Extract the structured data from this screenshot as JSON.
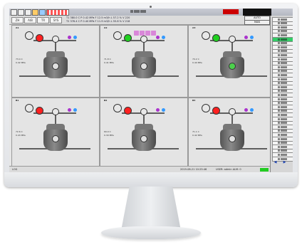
{
  "window": {
    "title_glyphs": 5
  },
  "toolbar": {
    "buttons": [
      "ZH",
      "A/B",
      "TR",
      "SYS"
    ],
    "status_line1": "T1 380.0 C  P 0.42 MPa  F 12.5 m3/h  L 57.2 %  V 220",
    "status_line2": "T2 376.4 C  P 0.40 MPa  F 11.9 m3/h  L 55.8 %  V 218",
    "mode_buttons": [
      "AUTO",
      "MAN"
    ]
  },
  "overlay_title_glyphs": 4,
  "panels": [
    {
      "id": "A1",
      "temp": "73.4",
      "press": "0.42",
      "lamp_color": "#ff2020",
      "cone_color": "#e0e0e0"
    },
    {
      "id": "A2",
      "temp": "71.8",
      "press": "0.41",
      "lamp_color": "#20d020",
      "cone_color": "#e0e0e0"
    },
    {
      "id": "A3",
      "temp": "70.2",
      "press": "0.40",
      "lamp_color": "#20d020",
      "cone_color": "#4cd04c"
    },
    {
      "id": "B1",
      "temp": "72.6",
      "press": "0.43",
      "lamp_color": "#ff2020",
      "cone_color": "#e0e0e0"
    },
    {
      "id": "B2",
      "temp": "69.9",
      "press": "0.39",
      "lamp_color": "#ff2020",
      "cone_color": "#e0e0e0"
    },
    {
      "id": "B3",
      "temp": "71.1",
      "press": "0.42",
      "lamp_color": "#ff2020",
      "cone_color": "#e0e0e0"
    }
  ],
  "sidebar": {
    "items": [
      {
        "label_glyphs": 4,
        "active": false
      },
      {
        "label_glyphs": 4,
        "active": false
      },
      {
        "label_glyphs": 4,
        "active": false
      },
      {
        "label_glyphs": 4,
        "active": false
      },
      {
        "label_glyphs": 4,
        "active": false
      },
      {
        "label_glyphs": 4,
        "active": true
      },
      {
        "label_glyphs": 4,
        "active": false
      },
      {
        "label_glyphs": 4,
        "active": false
      },
      {
        "label_glyphs": 4,
        "active": false
      },
      {
        "label_glyphs": 4,
        "active": false
      },
      {
        "label_glyphs": 4,
        "active": false
      },
      {
        "label_glyphs": 4,
        "active": false
      },
      {
        "label_glyphs": 4,
        "active": false
      },
      {
        "label_glyphs": 4,
        "active": false
      },
      {
        "label_glyphs": 4,
        "active": false
      },
      {
        "label_glyphs": 4,
        "active": false
      },
      {
        "label_glyphs": 4,
        "active": false
      },
      {
        "label_glyphs": 4,
        "active": false
      },
      {
        "label_glyphs": 4,
        "active": false
      },
      {
        "label_glyphs": 4,
        "active": false
      },
      {
        "label_glyphs": 4,
        "active": false
      },
      {
        "label_glyphs": 4,
        "active": false
      },
      {
        "label_glyphs": 4,
        "active": false
      },
      {
        "label_glyphs": 4,
        "active": false
      },
      {
        "label_glyphs": 4,
        "active": false
      },
      {
        "label_glyphs": 4,
        "active": false
      },
      {
        "label_glyphs": 4,
        "active": false
      },
      {
        "label_glyphs": 4,
        "active": false
      },
      {
        "label_glyphs": 4,
        "active": false
      },
      {
        "label_glyphs": 4,
        "active": false
      },
      {
        "label_glyphs": 4,
        "active": false
      },
      {
        "label_glyphs": 4,
        "active": false
      },
      {
        "label_glyphs": 4,
        "active": false
      },
      {
        "label_glyphs": 4,
        "active": false
      },
      {
        "label_glyphs": 4,
        "active": false
      },
      {
        "label_glyphs": 4,
        "active": false
      }
    ],
    "prev_arrow": "◀",
    "next_arrow": "▶"
  },
  "bottombar": {
    "left_text": "LOG",
    "mid_text": "2019-08-21 10:25:46",
    "right_text": "USER: admin   ALM: 0"
  },
  "colors": {
    "accent": "#d03bd0",
    "alarm": "#cc0000",
    "run": "#22cc22"
  },
  "icons": [
    "app-icon",
    "save-icon",
    "print-icon",
    "palette-icon",
    "chart-icon",
    "fan-icon",
    "valve-icon"
  ]
}
